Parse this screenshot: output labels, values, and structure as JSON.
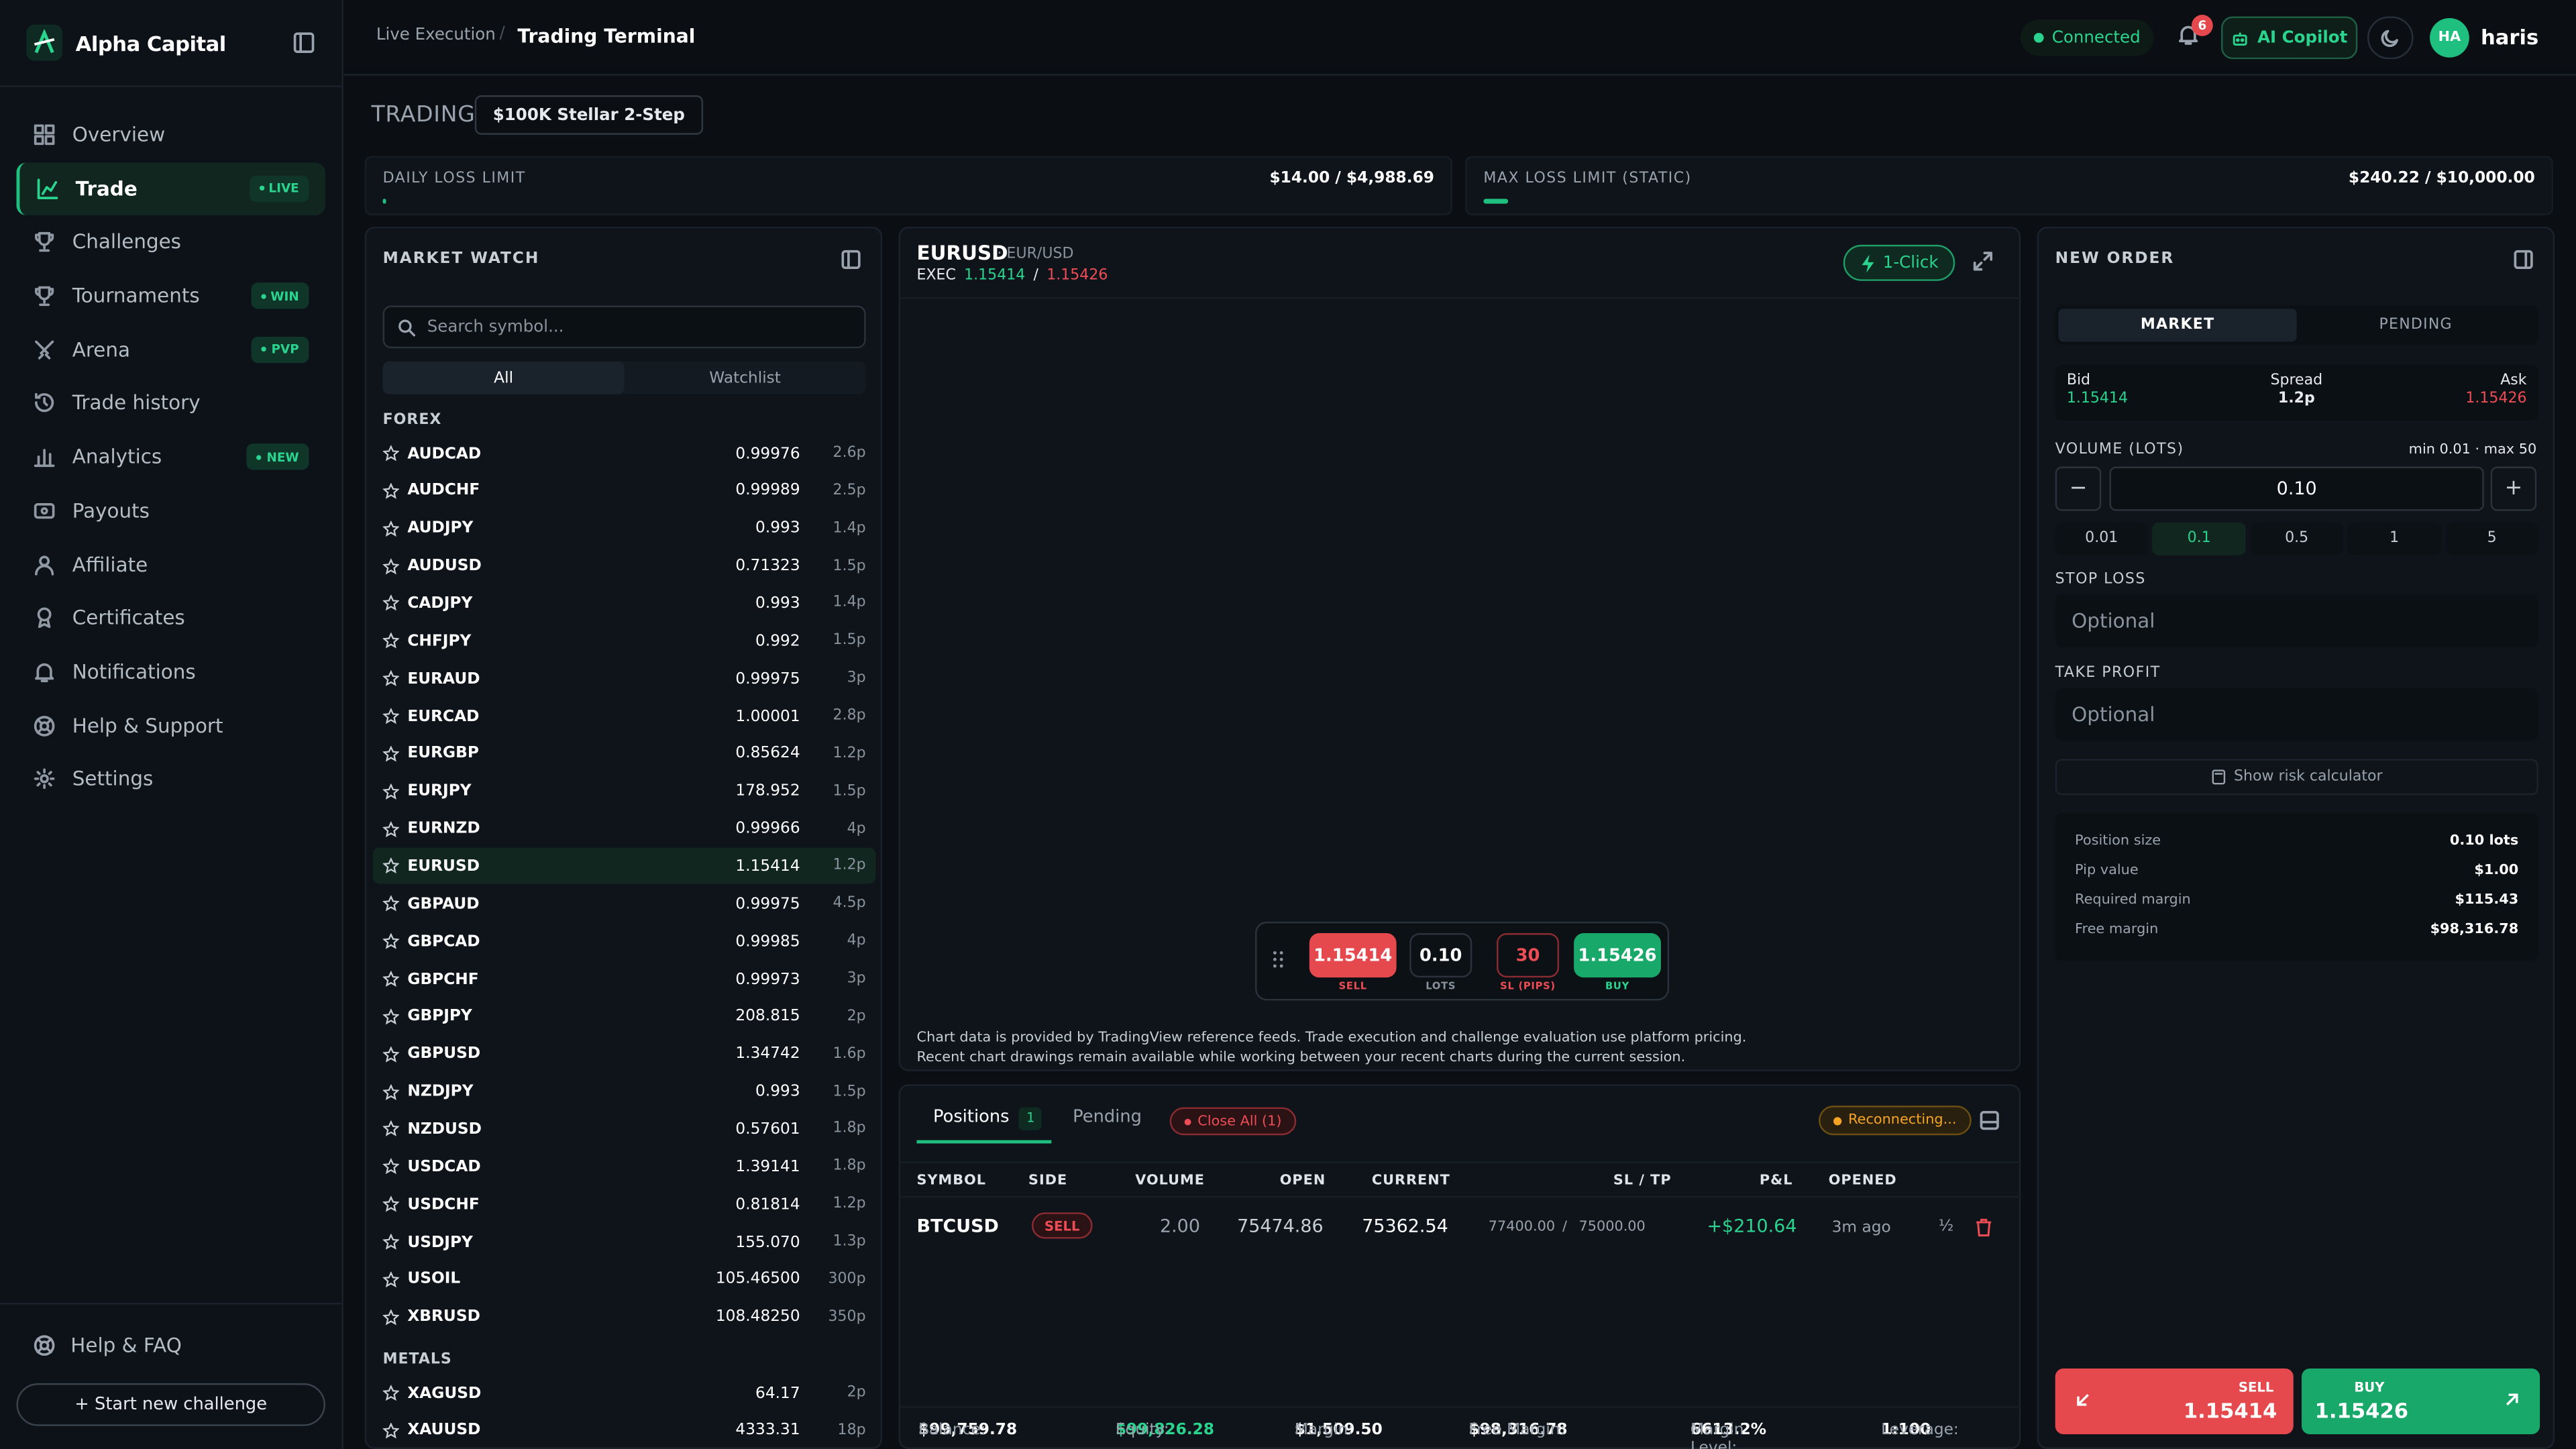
{
  "sidebar": {
    "brand": "Alpha Capital",
    "items": [
      {
        "label": "Overview"
      },
      {
        "label": "Trade",
        "badge": "LIVE"
      },
      {
        "label": "Challenges"
      },
      {
        "label": "Tournaments",
        "badge": "WIN"
      },
      {
        "label": "Arena",
        "badge": "PVP"
      },
      {
        "label": "Trade history"
      },
      {
        "label": "Analytics",
        "badge": "NEW"
      },
      {
        "label": "Payouts"
      },
      {
        "label": "Affiliate"
      },
      {
        "label": "Certificates"
      },
      {
        "label": "Notifications"
      },
      {
        "label": "Help & Support"
      },
      {
        "label": "Settings"
      }
    ],
    "help_faq": "Help & FAQ",
    "start_button": "+ Start new challenge"
  },
  "topbar": {
    "crumb1": "Live Execution",
    "crumb_sep": "/",
    "crumb2": "Trading Terminal",
    "status": "Connected",
    "notif_count": "6",
    "copilot": "AI Copilot",
    "avatar": "HA",
    "user": "haris"
  },
  "trading": {
    "label": "TRADING",
    "account": "$100K Stellar 2-Step",
    "daily_loss": {
      "title": "DAILY LOSS LIMIT",
      "value": "$14.00 / $4,988.69",
      "fraction": 0.003
    },
    "max_loss": {
      "title": "MAX LOSS LIMIT (STATIC)",
      "value": "$240.22 / $10,000.00",
      "fraction": 0.024
    }
  },
  "market_watch": {
    "title": "MARKET WATCH",
    "search_placeholder": "Search symbol...",
    "tabs": [
      "All",
      "Watchlist"
    ],
    "forex_label": "FOREX",
    "metals_label": "METALS",
    "forex": [
      [
        "AUDCAD",
        "0.99976",
        "2.6p"
      ],
      [
        "AUDCHF",
        "0.99989",
        "2.5p"
      ],
      [
        "AUDJPY",
        "0.993",
        "1.4p"
      ],
      [
        "AUDUSD",
        "0.71323",
        "1.5p"
      ],
      [
        "CADJPY",
        "0.993",
        "1.4p"
      ],
      [
        "CHFJPY",
        "0.992",
        "1.5p"
      ],
      [
        "EURAUD",
        "0.99975",
        "3p"
      ],
      [
        "EURCAD",
        "1.00001",
        "2.8p"
      ],
      [
        "EURGBP",
        "0.85624",
        "1.2p"
      ],
      [
        "EURJPY",
        "178.952",
        "1.5p"
      ],
      [
        "EURNZD",
        "0.99966",
        "4p"
      ],
      [
        "EURUSD",
        "1.15414",
        "1.2p"
      ],
      [
        "GBPAUD",
        "0.99975",
        "4.5p"
      ],
      [
        "GBPCAD",
        "0.99985",
        "4p"
      ],
      [
        "GBPCHF",
        "0.99973",
        "3p"
      ],
      [
        "GBPJPY",
        "208.815",
        "2p"
      ],
      [
        "GBPUSD",
        "1.34742",
        "1.6p"
      ],
      [
        "NZDJPY",
        "0.993",
        "1.5p"
      ],
      [
        "NZDUSD",
        "0.57601",
        "1.8p"
      ],
      [
        "USDCAD",
        "1.39141",
        "1.8p"
      ],
      [
        "USDCHF",
        "0.81814",
        "1.2p"
      ],
      [
        "USDJPY",
        "155.070",
        "1.3p"
      ],
      [
        "USOIL",
        "105.46500",
        "300p"
      ],
      [
        "XBRUSD",
        "108.48250",
        "350p"
      ]
    ],
    "metals": [
      [
        "XAGUSD",
        "64.17",
        "2p"
      ],
      [
        "XAUUSD",
        "4333.31",
        "18p"
      ]
    ]
  },
  "chart": {
    "symbol": "EURUSD",
    "subtitle": "· EUR/USD",
    "exec_label": "EXEC",
    "exec_bid": "1.15414",
    "exec_sep": "/",
    "exec_ask": "1.15426",
    "one_click": "1-Click",
    "bar": {
      "sell": "1.15414",
      "sell_cap": "SELL",
      "lots": "0.10",
      "lots_cap": "LOTS",
      "sl": "30",
      "sl_cap": "SL (PIPS)",
      "buy": "1.15426",
      "buy_cap": "BUY"
    },
    "note1": "Chart data is provided by TradingView reference feeds. Trade execution and challenge evaluation use platform pricing.",
    "note2": "Recent chart drawings remain available while working between your recent charts during the current session."
  },
  "positions": {
    "tab_positions": "Positions",
    "count": "1",
    "tab_pending": "Pending",
    "close_all": "Close All (1)",
    "reconnecting": "Reconnecting...",
    "headers": [
      "SYMBOL",
      "SIDE",
      "VOLUME",
      "OPEN",
      "CURRENT",
      "SL / TP",
      "P&L",
      "OPENED"
    ],
    "row": {
      "symbol": "BTCUSD",
      "side": "SELL",
      "volume": "2.00",
      "open": "75474.86",
      "current": "75362.54",
      "sl": "77400.00",
      "sltp_sep": "/",
      "tp": "75000.00",
      "pnl": "+$210.64",
      "opened": "3m ago",
      "half": "½"
    },
    "footer": {
      "balance_label": "Balance:",
      "balance": "$99,759.78",
      "equity_label": "Equity:",
      "equity": "$99,826.28",
      "margin_label": "Margin:",
      "margin": "$1,509.50",
      "free_label": "Free Margin:",
      "free": "$98,316.78",
      "level_label": "Margin Level:",
      "level": "6613.2%",
      "lev_label": "Leverage:",
      "leverage": "1:100"
    }
  },
  "order": {
    "title": "NEW ORDER",
    "tabs": [
      "MARKET",
      "PENDING"
    ],
    "bid_label": "Bid",
    "bid": "1.15414",
    "spread_label": "Spread",
    "spread": "1.2p",
    "ask_label": "Ask",
    "ask": "1.15426",
    "volume_label": "VOLUME (LOTS)",
    "volume_limits": "min 0.01 · max 50",
    "volume": "0.10",
    "minus": "−",
    "plus": "+",
    "presets": [
      "0.01",
      "0.1",
      "0.5",
      "1",
      "5"
    ],
    "stop_loss_label": "STOP LOSS",
    "take_profit_label": "TAKE PROFIT",
    "optional": "Optional",
    "risk_calc": "Show risk calculator",
    "summary": [
      [
        "Position size",
        "0.10 lots"
      ],
      [
        "Pip value",
        "$1.00"
      ],
      [
        "Required margin",
        "$115.43"
      ],
      [
        "Free margin",
        "$98,316.78"
      ]
    ],
    "sell": {
      "label": "SELL",
      "price": "1.15414"
    },
    "buy": {
      "label": "BUY",
      "price": "1.15426"
    }
  },
  "colors": {
    "accent": "#1fbf7f",
    "sell": "#e5484d",
    "buy": "#17a86a",
    "background": "#0b0f14"
  }
}
